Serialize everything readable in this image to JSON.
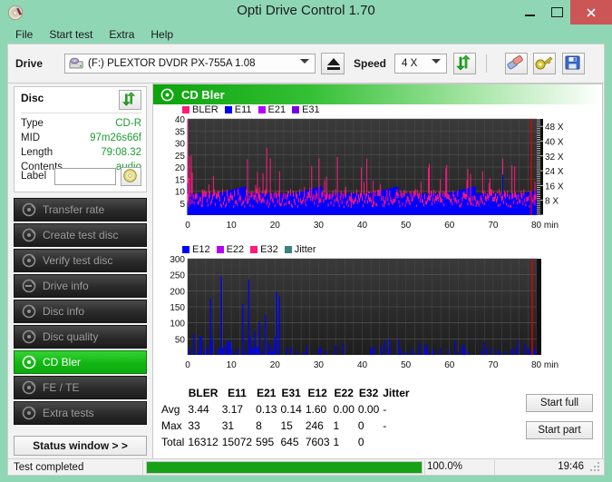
{
  "window": {
    "title": "Opti Drive Control 1.70",
    "icon": "disc-icon",
    "controls": {
      "minimize": "–",
      "maximize": "❐",
      "close": "✕"
    }
  },
  "menu": {
    "items": [
      "File",
      "Start test",
      "Extra",
      "Help"
    ]
  },
  "toolbar": {
    "drive_label": "Drive",
    "drive_value": "(F:)   PLEXTOR DVDR   PX-755A 1.08",
    "eject_icon": "eject-icon",
    "speed_label": "Speed",
    "speed_value": "4 X",
    "refresh_icon": "refresh-arrows-icon",
    "erase_icon": "eraser-icon",
    "settings_icon": "gold-key-icon",
    "save_icon": "floppy-save-icon"
  },
  "disc": {
    "title": "Disc",
    "refresh_icon": "refresh-arrows-icon",
    "rows": [
      {
        "key": "Type",
        "value": "CD-R"
      },
      {
        "key": "MID",
        "value": "97m26s66f"
      },
      {
        "key": "Length",
        "value": "79:08.32"
      },
      {
        "key": "Contents",
        "value": "audio"
      }
    ],
    "label_caption": "Label",
    "label_value": "",
    "label_placeholder": "",
    "label_button_icon": "cd-disc-icon"
  },
  "nav": {
    "items": [
      {
        "label": "Transfer rate",
        "icon": "disc-test-icon",
        "active": false
      },
      {
        "label": "Create test disc",
        "icon": "disc-burn-icon",
        "active": false
      },
      {
        "label": "Verify test disc",
        "icon": "disc-verify-icon",
        "active": false
      },
      {
        "label": "Drive info",
        "icon": "drive-info-icon",
        "active": false
      },
      {
        "label": "Disc info",
        "icon": "disc-info-icon",
        "active": false
      },
      {
        "label": "Disc quality",
        "icon": "disc-quality-icon",
        "active": false
      },
      {
        "label": "CD Bler",
        "icon": "cd-bler-icon",
        "active": true
      },
      {
        "label": "FE / TE",
        "icon": "fe-te-icon",
        "active": false
      },
      {
        "label": "Extra tests",
        "icon": "extra-tests-icon",
        "active": false
      }
    ],
    "status_window": "Status window > >"
  },
  "panel": {
    "title": "CD Bler",
    "icon": "cd-bler-icon"
  },
  "actions": {
    "start_full": "Start full",
    "start_part": "Start part"
  },
  "statusbar": {
    "message": "Test completed",
    "progress_percent": "100.0%",
    "progress_value": 100,
    "time": "19:46"
  },
  "stats": {
    "columns": [
      "BLER",
      "E11",
      "E21",
      "E31",
      "E12",
      "E22",
      "E32",
      "Jitter"
    ],
    "rows": [
      {
        "label": "Avg",
        "values": [
          "3.44",
          "3.17",
          "0.13",
          "0.14",
          "1.60",
          "0.00",
          "0.00",
          "-"
        ]
      },
      {
        "label": "Max",
        "values": [
          "33",
          "31",
          "8",
          "15",
          "246",
          "1",
          "0",
          "-"
        ]
      },
      {
        "label": "Total",
        "values": [
          "16312",
          "15072",
          "595",
          "645",
          "7603",
          "1",
          "0",
          ""
        ]
      }
    ]
  },
  "colors": {
    "bler": "#ff1a7a",
    "e11": "#0000ff",
    "e21": "#b300ff",
    "e31": "#7a00e6",
    "e12": "#0000ff",
    "e22": "#b300ff",
    "e32": "#ff1a7a",
    "jitter": "#3d8080",
    "speed_line": "#e00000",
    "plot_bg": "#2b2b2b",
    "accent_green": "#12b712",
    "value_green": "#1a9d2f",
    "window_chrome": "#8fd6b4",
    "close_red": "#cc5555"
  },
  "chart_data": [
    {
      "type": "line",
      "id": "cd-bler-error-chart",
      "title": "CD Bler",
      "xlabel": "min",
      "ylabel": "",
      "xlim": [
        0,
        80
      ],
      "ylim": [
        0,
        40
      ],
      "xticks": [
        0,
        10,
        20,
        30,
        40,
        50,
        60,
        70,
        80
      ],
      "yticks": [
        5,
        10,
        15,
        20,
        25,
        30,
        35,
        40
      ],
      "right_axis_label": "X",
      "right_ticks": [
        "8 X",
        "16 X",
        "24 X",
        "32 X",
        "40 X",
        "48 X"
      ],
      "right_ylim": [
        0,
        52
      ],
      "grid": true,
      "legend_position": "top-left",
      "legend": [
        {
          "name": "BLER",
          "color": "#ff1a7a"
        },
        {
          "name": "E11",
          "color": "#0000ff"
        },
        {
          "name": "E21",
          "color": "#b300ff"
        },
        {
          "name": "E31",
          "color": "#7a00e6"
        }
      ],
      "series": [
        {
          "name": "BLER",
          "color": "#ff1a7a",
          "avg": 3.44,
          "max": 33,
          "total": 16312,
          "values": [
            27,
            33,
            20,
            14,
            10,
            16,
            11,
            9,
            13,
            12,
            20,
            9,
            11,
            8,
            14,
            9,
            7,
            13,
            32,
            8,
            10,
            22,
            9,
            14,
            8,
            11,
            13,
            9,
            17,
            10,
            8,
            14,
            11,
            9,
            16,
            10,
            8,
            12,
            15,
            9,
            17,
            11,
            8,
            14,
            10,
            16,
            9,
            12,
            8,
            15,
            10,
            7,
            13,
            9,
            11,
            18,
            8,
            14,
            10,
            12,
            9,
            16,
            11,
            8,
            20,
            13,
            9,
            15,
            10,
            8,
            14,
            11,
            17,
            9,
            12,
            8,
            16,
            10,
            13,
            9,
            11,
            15,
            8,
            12,
            19,
            10,
            14,
            9,
            11,
            8,
            13,
            16,
            10,
            12,
            9,
            15,
            11,
            8,
            14,
            10,
            12,
            9,
            17,
            11,
            8,
            13,
            10,
            15,
            9,
            12,
            8,
            14,
            11,
            10,
            16,
            9,
            13,
            8,
            12,
            11,
            25,
            15,
            9,
            13,
            10,
            12,
            8,
            11,
            9,
            14,
            10,
            13
          ]
        },
        {
          "name": "E11",
          "color": "#0000ff",
          "avg": 3.17,
          "max": 31,
          "total": 15072,
          "values": [
            22,
            31,
            12,
            8,
            6,
            9,
            7,
            5,
            8,
            7,
            12,
            5,
            7,
            4,
            8,
            5,
            4,
            7,
            32,
            5,
            6,
            13,
            5,
            8,
            4,
            6,
            7,
            5,
            10,
            6,
            4,
            8,
            6,
            5,
            9,
            6,
            4,
            7,
            9,
            5,
            10,
            6,
            4,
            8,
            6,
            9,
            5,
            7,
            4,
            9,
            6,
            4,
            7,
            5,
            6,
            11,
            4,
            8,
            6,
            7,
            5,
            9,
            6,
            4,
            12,
            7,
            5,
            8,
            6,
            4,
            8,
            6,
            10,
            5,
            7,
            4,
            9,
            6,
            7,
            5,
            6,
            9,
            4,
            7,
            11,
            6,
            8,
            5,
            6,
            4,
            7,
            9,
            6,
            7,
            5,
            9,
            6,
            4,
            8,
            6,
            7,
            5,
            10,
            6,
            4,
            7,
            6,
            9,
            5,
            7,
            4,
            8,
            6,
            5,
            9,
            5,
            7,
            4,
            7,
            6,
            14,
            9,
            5,
            7,
            6,
            7,
            4,
            6,
            5,
            8,
            6,
            7
          ]
        },
        {
          "name": "E21",
          "color": "#b300ff",
          "avg": 0.13,
          "max": 8,
          "total": 595,
          "values": [
            2,
            3,
            1,
            0,
            0,
            1,
            0,
            0,
            1,
            0,
            2,
            0,
            0,
            0,
            1,
            0,
            0,
            1,
            3,
            0,
            0,
            2,
            0,
            1,
            0,
            0,
            1,
            0,
            2,
            0,
            0,
            1,
            0,
            0,
            1,
            0,
            0,
            1,
            2,
            0,
            1,
            0,
            0,
            1,
            0,
            1,
            0,
            1,
            0,
            1,
            0,
            0,
            1,
            0,
            0,
            2,
            0,
            1,
            0,
            1,
            0,
            1,
            0,
            0,
            2,
            1,
            0,
            1,
            0,
            0,
            1,
            0,
            2,
            0,
            1,
            0,
            1,
            0,
            1,
            0,
            0,
            1,
            0,
            1,
            2,
            0,
            1,
            0,
            0,
            0,
            1,
            2,
            0,
            1,
            0,
            1,
            0,
            0,
            1,
            0,
            1,
            0,
            2,
            0,
            0,
            1,
            0,
            1,
            0,
            1,
            0,
            1,
            0,
            0,
            1,
            0,
            1,
            0,
            1,
            0,
            3,
            1,
            0,
            1,
            0,
            1,
            0,
            0,
            0,
            1,
            0,
            1
          ]
        },
        {
          "name": "E31",
          "color": "#7a00e6",
          "avg": 0.14,
          "max": 15,
          "total": 645,
          "values": [
            2,
            4,
            1,
            0,
            0,
            1,
            0,
            0,
            1,
            0,
            2,
            0,
            0,
            0,
            1,
            0,
            0,
            1,
            4,
            0,
            0,
            2,
            0,
            1,
            0,
            0,
            1,
            0,
            2,
            0,
            0,
            1,
            0,
            0,
            1,
            0,
            0,
            1,
            2,
            0,
            1,
            0,
            0,
            1,
            0,
            1,
            0,
            1,
            0,
            1,
            0,
            0,
            1,
            0,
            0,
            2,
            0,
            1,
            0,
            1,
            0,
            1,
            0,
            0,
            2,
            1,
            0,
            1,
            0,
            0,
            1,
            0,
            2,
            0,
            1,
            0,
            1,
            0,
            1,
            0,
            0,
            1,
            0,
            1,
            2,
            0,
            1,
            0,
            0,
            0,
            1,
            2,
            0,
            1,
            0,
            1,
            0,
            0,
            1,
            0,
            1,
            0,
            2,
            0,
            0,
            1,
            0,
            1,
            0,
            1,
            0,
            1,
            0,
            0,
            1,
            0,
            1,
            0,
            1,
            0,
            3,
            1,
            0,
            1,
            0,
            1,
            0,
            0,
            0,
            1,
            0,
            1
          ]
        },
        {
          "name": "Speed",
          "color": "#e00000",
          "unit": "X",
          "start": 4,
          "end": 48,
          "note": "red write/read speed trace rising at far right edge to 48X"
        }
      ]
    },
    {
      "type": "line",
      "id": "cd-bler-e12-chart",
      "title": "",
      "xlabel": "min",
      "ylabel": "",
      "xlim": [
        0,
        80
      ],
      "ylim": [
        0,
        300
      ],
      "xticks": [
        0,
        10,
        20,
        30,
        40,
        50,
        60,
        70,
        80
      ],
      "yticks": [
        50,
        100,
        150,
        200,
        250,
        300
      ],
      "grid": true,
      "legend_position": "top-left",
      "legend": [
        {
          "name": "E12",
          "color": "#0000ff"
        },
        {
          "name": "E22",
          "color": "#b300ff"
        },
        {
          "name": "E32",
          "color": "#ff1a7a"
        },
        {
          "name": "Jitter",
          "color": "#3d8080"
        }
      ],
      "series": [
        {
          "name": "E12",
          "color": "#0000ff",
          "avg": 1.6,
          "max": 246,
          "total": 7603,
          "values": [
            0,
            0,
            0,
            0,
            65,
            0,
            0,
            10,
            58,
            57,
            0,
            0,
            0,
            30,
            0,
            175,
            52,
            0,
            0,
            0,
            20,
            18,
            245,
            22,
            30,
            0,
            45,
            40,
            46,
            18,
            0,
            0,
            5,
            0,
            0,
            0,
            160,
            12,
            0,
            0,
            235,
            55,
            22,
            20,
            74,
            0,
            0,
            102,
            0,
            0,
            0,
            125,
            0,
            38,
            0,
            0,
            12,
            55,
            197,
            0,
            182,
            0,
            0,
            0,
            0,
            0,
            0,
            0,
            0,
            0,
            0,
            0,
            0,
            0,
            0,
            0,
            0,
            0,
            0,
            0,
            0,
            0,
            0,
            0,
            0,
            0,
            0,
            0,
            0,
            0,
            0,
            0,
            0,
            0,
            0,
            0,
            0,
            0,
            0,
            0,
            0,
            0,
            0,
            0,
            0,
            0,
            0,
            0,
            0,
            0,
            0,
            0,
            0,
            0,
            0,
            0,
            0,
            0,
            0,
            0,
            0,
            0,
            0,
            0,
            0,
            0,
            0,
            0
          ]
        },
        {
          "name": "E22",
          "color": "#b300ff",
          "avg": 0.0,
          "max": 1,
          "total": 1,
          "values": []
        },
        {
          "name": "E32",
          "color": "#ff1a7a",
          "avg": 0.0,
          "max": 0,
          "total": 0,
          "values": []
        },
        {
          "name": "Jitter",
          "color": "#3d8080",
          "avg": null,
          "max": null,
          "total": null,
          "values": []
        }
      ]
    }
  ]
}
